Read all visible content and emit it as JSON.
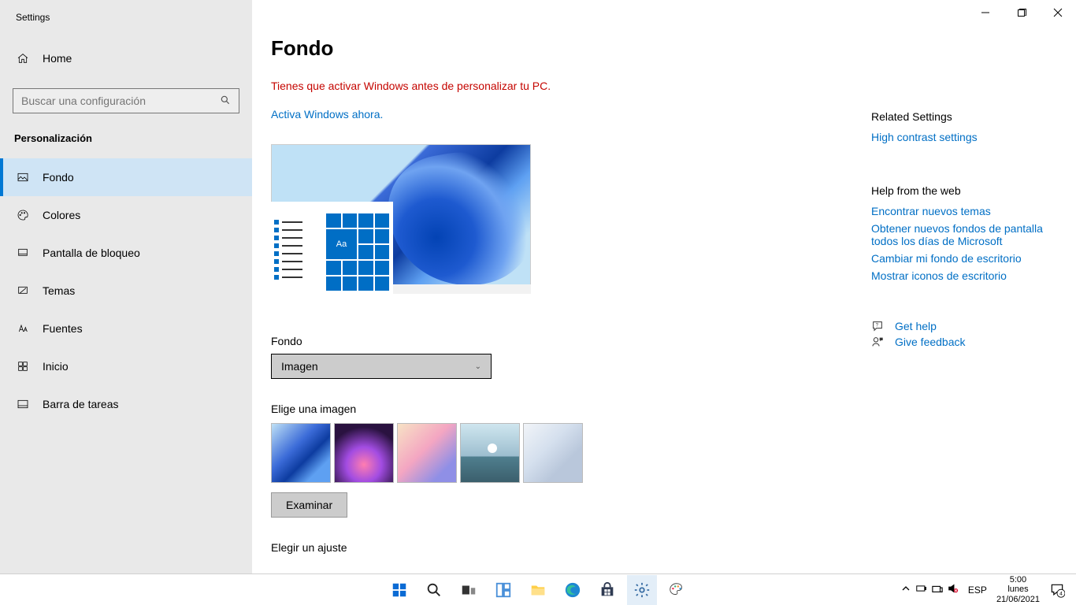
{
  "window": {
    "title": "Settings"
  },
  "sidebar": {
    "home_label": "Home",
    "search_placeholder": "Buscar una configuración",
    "category": "Personalización",
    "items": [
      {
        "label": "Fondo"
      },
      {
        "label": "Colores"
      },
      {
        "label": "Pantalla de bloqueo"
      },
      {
        "label": "Temas"
      },
      {
        "label": "Fuentes"
      },
      {
        "label": "Inicio"
      },
      {
        "label": "Barra de tareas"
      }
    ]
  },
  "main": {
    "title": "Fondo",
    "activation_warning": "Tienes que activar Windows antes de personalizar tu PC.",
    "activation_link": "Activa Windows ahora.",
    "preview_sample": "Aa",
    "background_label": "Fondo",
    "background_value": "Imagen",
    "choose_image_label": "Elige una imagen",
    "browse_label": "Examinar",
    "fit_label": "Elegir un ajuste"
  },
  "related": {
    "header": "Related Settings",
    "links": [
      "High contrast settings"
    ],
    "help_header": "Help from the web",
    "help_links": [
      "Encontrar nuevos temas",
      "Obtener nuevos fondos de pantalla todos los días de Microsoft",
      "Cambiar mi fondo de escritorio",
      "Mostrar iconos de escritorio"
    ],
    "get_help": "Get help",
    "give_feedback": "Give feedback"
  },
  "taskbar": {
    "lang": "ESP",
    "time": "5:00",
    "day": "lunes",
    "date": "21/06/2021",
    "notif_count": "4"
  }
}
